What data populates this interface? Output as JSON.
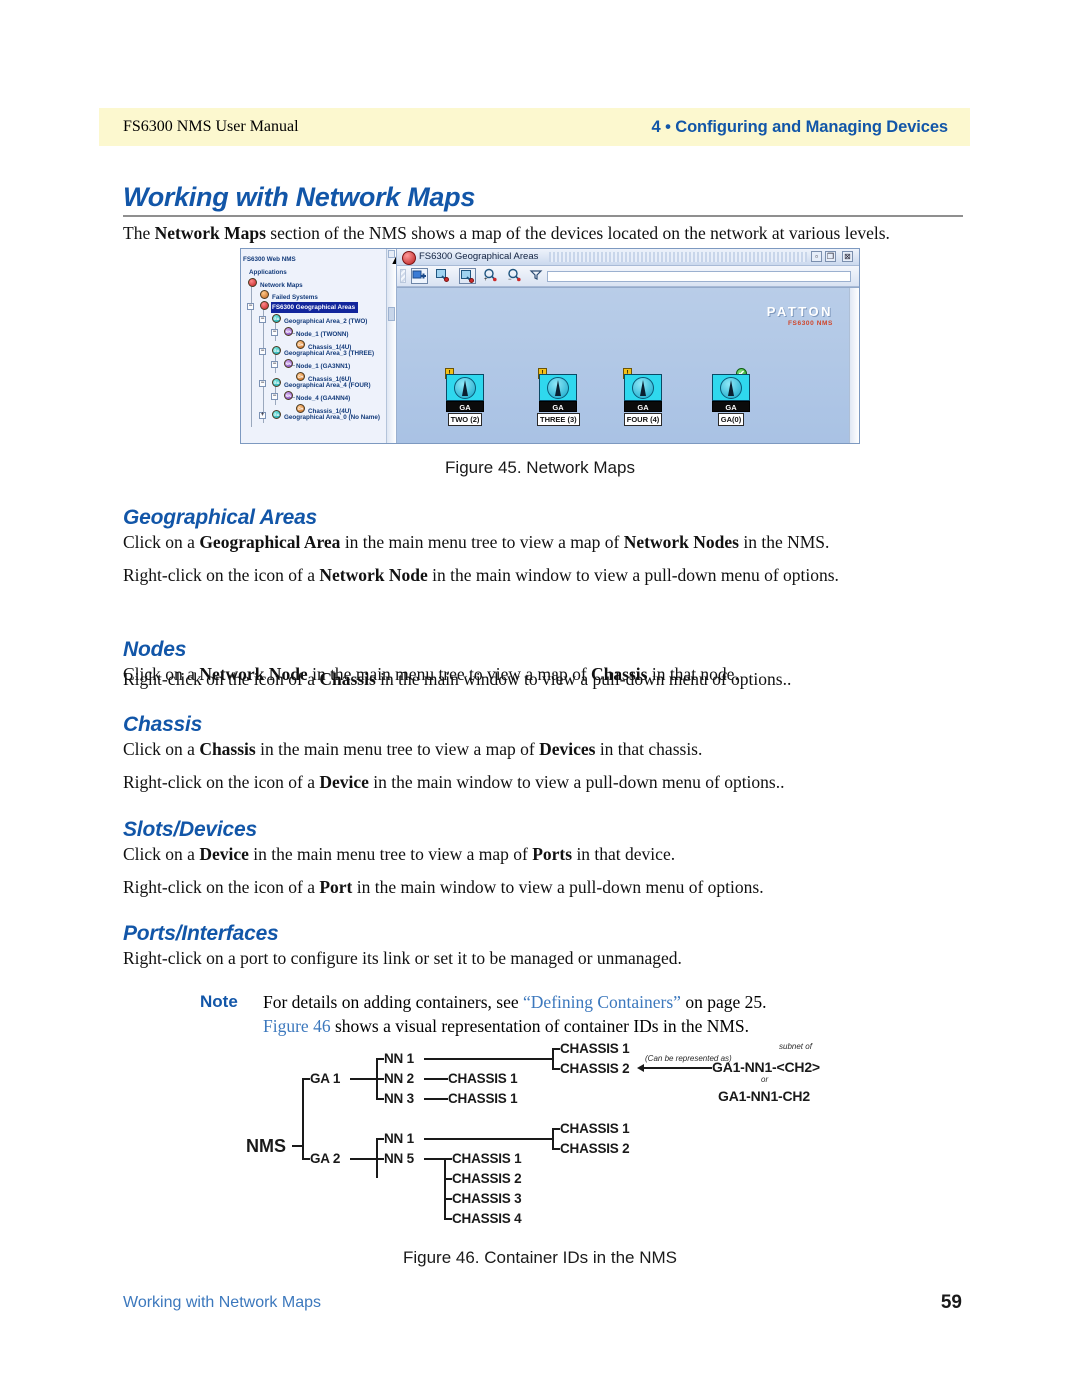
{
  "header": {
    "left": "FS6300 NMS User Manual",
    "right": "4 • Configuring and Managing Devices"
  },
  "page_title": "Working with Network Maps",
  "intro": {
    "p1_a": "The ",
    "p1_b": "Network Maps",
    "p1_c": " section of the NMS shows a map of the devices located on the network at various levels."
  },
  "figure45": {
    "caption": "Figure 45. Network Maps",
    "window_title": "FS6300 Geographical Areas",
    "window_buttons": [
      "minimize-icon",
      "maximize-icon",
      "close-icon"
    ],
    "toolbar_icons": [
      "add-node-icon",
      "map-background-icon",
      "map-zoom-region-icon",
      "zoom-in-icon",
      "zoom-out-icon",
      "filter-dropdown-icon"
    ],
    "brand": {
      "word": "PATTON",
      "sub": "FS6300 NMS"
    },
    "tree": [
      {
        "label": "FS6300 Web NMS",
        "depth": 0,
        "icon": "none",
        "toggle": "none",
        "selected": false
      },
      {
        "label": "Applications",
        "depth": 1,
        "icon": "none",
        "toggle": "none",
        "selected": false
      },
      {
        "label": "Network Maps",
        "depth": 1,
        "icon": "red",
        "toggle": "none",
        "selected": false
      },
      {
        "label": "Failed Systems",
        "depth": 2,
        "icon": "orange",
        "toggle": "none",
        "selected": false
      },
      {
        "label": "FS6300 Geographical Areas",
        "depth": 2,
        "icon": "red",
        "toggle": "minus",
        "selected": true
      },
      {
        "label": "Geographical Area_2 (TWO)",
        "depth": 3,
        "icon": "teal",
        "toggle": "minus",
        "selected": false
      },
      {
        "label": "Node_1 (TWONN)",
        "depth": 4,
        "icon": "purple",
        "toggle": "minus",
        "selected": false
      },
      {
        "label": "Chassis_1(4U)",
        "depth": 5,
        "icon": "orange",
        "toggle": "none",
        "selected": false
      },
      {
        "label": "Geographical Area_3 (THREE)",
        "depth": 3,
        "icon": "teal",
        "toggle": "minus",
        "selected": false
      },
      {
        "label": "Node_1 (GA3NN1)",
        "depth": 4,
        "icon": "purple",
        "toggle": "minus",
        "selected": false
      },
      {
        "label": "Chassis_1(6U)",
        "depth": 5,
        "icon": "orange",
        "toggle": "none",
        "selected": false
      },
      {
        "label": "Geographical Area_4 (FOUR)",
        "depth": 3,
        "icon": "teal",
        "toggle": "minus",
        "selected": false
      },
      {
        "label": "Node_4 (GA4NN4)",
        "depth": 4,
        "icon": "purple",
        "toggle": "minus",
        "selected": false
      },
      {
        "label": "Chassis_1(4U)",
        "depth": 5,
        "icon": "orange",
        "toggle": "none",
        "selected": false
      },
      {
        "label": "Geographical Area_0 (No Name)",
        "depth": 3,
        "icon": "teal",
        "toggle": "plus",
        "selected": false
      }
    ],
    "map_nodes": [
      {
        "type": "GA",
        "name": "TWO (2)",
        "status": "warning",
        "status_glyph": "!"
      },
      {
        "type": "GA",
        "name": "THREE (3)",
        "status": "warning",
        "status_glyph": "!"
      },
      {
        "type": "GA",
        "name": "FOUR (4)",
        "status": "warning",
        "status_glyph": "!"
      },
      {
        "type": "GA",
        "name": "GA(0)",
        "status": "ok",
        "status_glyph": "✔"
      }
    ]
  },
  "sections": [
    {
      "heading": "Geographical Areas",
      "p1": {
        "a": "Click on a ",
        "b1": "Geographical Area",
        "c": " in the main menu tree to view a map of ",
        "b2": "Network Nodes",
        "d": " in the NMS."
      },
      "p2": {
        "a": "Right-click on the icon of a ",
        "b1": "Network Node",
        "c": " in the main window to view a pull-down menu of options."
      }
    },
    {
      "heading": "Nodes",
      "p1": {
        "a": "Click on a ",
        "b1": "Network Node",
        "c": " in the main menu tree to view a map of ",
        "b2": "Chassis",
        "d": " in that node."
      },
      "p2": {
        "a": "Right-click on the icon of a ",
        "b1": "Chassis",
        "c": " in the main window to view a pull-down menu of options.."
      }
    },
    {
      "heading": "Chassis",
      "p1": {
        "a": "Click on a ",
        "b1": "Chassis",
        "c": " in the main menu tree to view a map of ",
        "b2": "Devices",
        "d": " in that chassis."
      },
      "p2": {
        "a": "Right-click on the icon of a ",
        "b1": "Device",
        "c": " in the main window to view a pull-down menu of options.."
      }
    },
    {
      "heading": "Slots/Devices",
      "p1": {
        "a": "Click on a ",
        "b1": "Device",
        "c": " in the main menu tree to view a map of ",
        "b2": "Ports",
        "d": " in that device."
      },
      "p2": {
        "a": "Right-click on the icon of a ",
        "b1": "Port",
        "c": " in the main window to view a pull-down menu of options."
      }
    },
    {
      "heading": "Ports/Interfaces",
      "p1": {
        "a": "Right-click on a port to configure its link or set it to be managed or unmanaged.",
        "b1": "",
        "c": "",
        "b2": "",
        "d": ""
      },
      "p2": null
    }
  ],
  "note": {
    "label": "Note",
    "line1_a": "For details on adding containers, see ",
    "line1_link": "“Defining Containers”",
    "line1_b": " on page 25.",
    "line2_link": "Figure 46",
    "line2_b": " shows a visual representation of container IDs in the NMS."
  },
  "figure46": {
    "caption": "Figure 46. Container IDs in the NMS",
    "root": "NMS",
    "branches": [
      {
        "ga": "GA 1",
        "nodes": [
          {
            "nn": "NN 1",
            "chassis": [
              "CHASSIS 1",
              "CHASSIS 2"
            ],
            "stacked": true
          },
          {
            "nn": "NN 2",
            "chassis": [
              "CHASSIS 1"
            ],
            "stacked": false
          },
          {
            "nn": "NN 3",
            "chassis": [
              "CHASSIS 1"
            ],
            "stacked": false
          }
        ]
      },
      {
        "ga": "GA 2",
        "nodes": [
          {
            "nn": "NN 1",
            "chassis": [
              "CHASSIS 1",
              "CHASSIS 2"
            ],
            "stacked": true
          },
          {
            "nn": "NN 5",
            "chassis": [
              "CHASSIS 1",
              "CHASSIS 2",
              "CHASSIS 3",
              "CHASSIS 4"
            ],
            "stacked": false
          }
        ]
      }
    ],
    "annotation": {
      "represented_as": "(Can be represented as)",
      "subnet_of": "subnet of",
      "id_bracketed": "GA1-NN1-<CH2>",
      "or": "or",
      "id_plain": "GA1-NN1-CH2"
    }
  },
  "footer": {
    "left": "Working with Network Maps",
    "page": "59"
  }
}
